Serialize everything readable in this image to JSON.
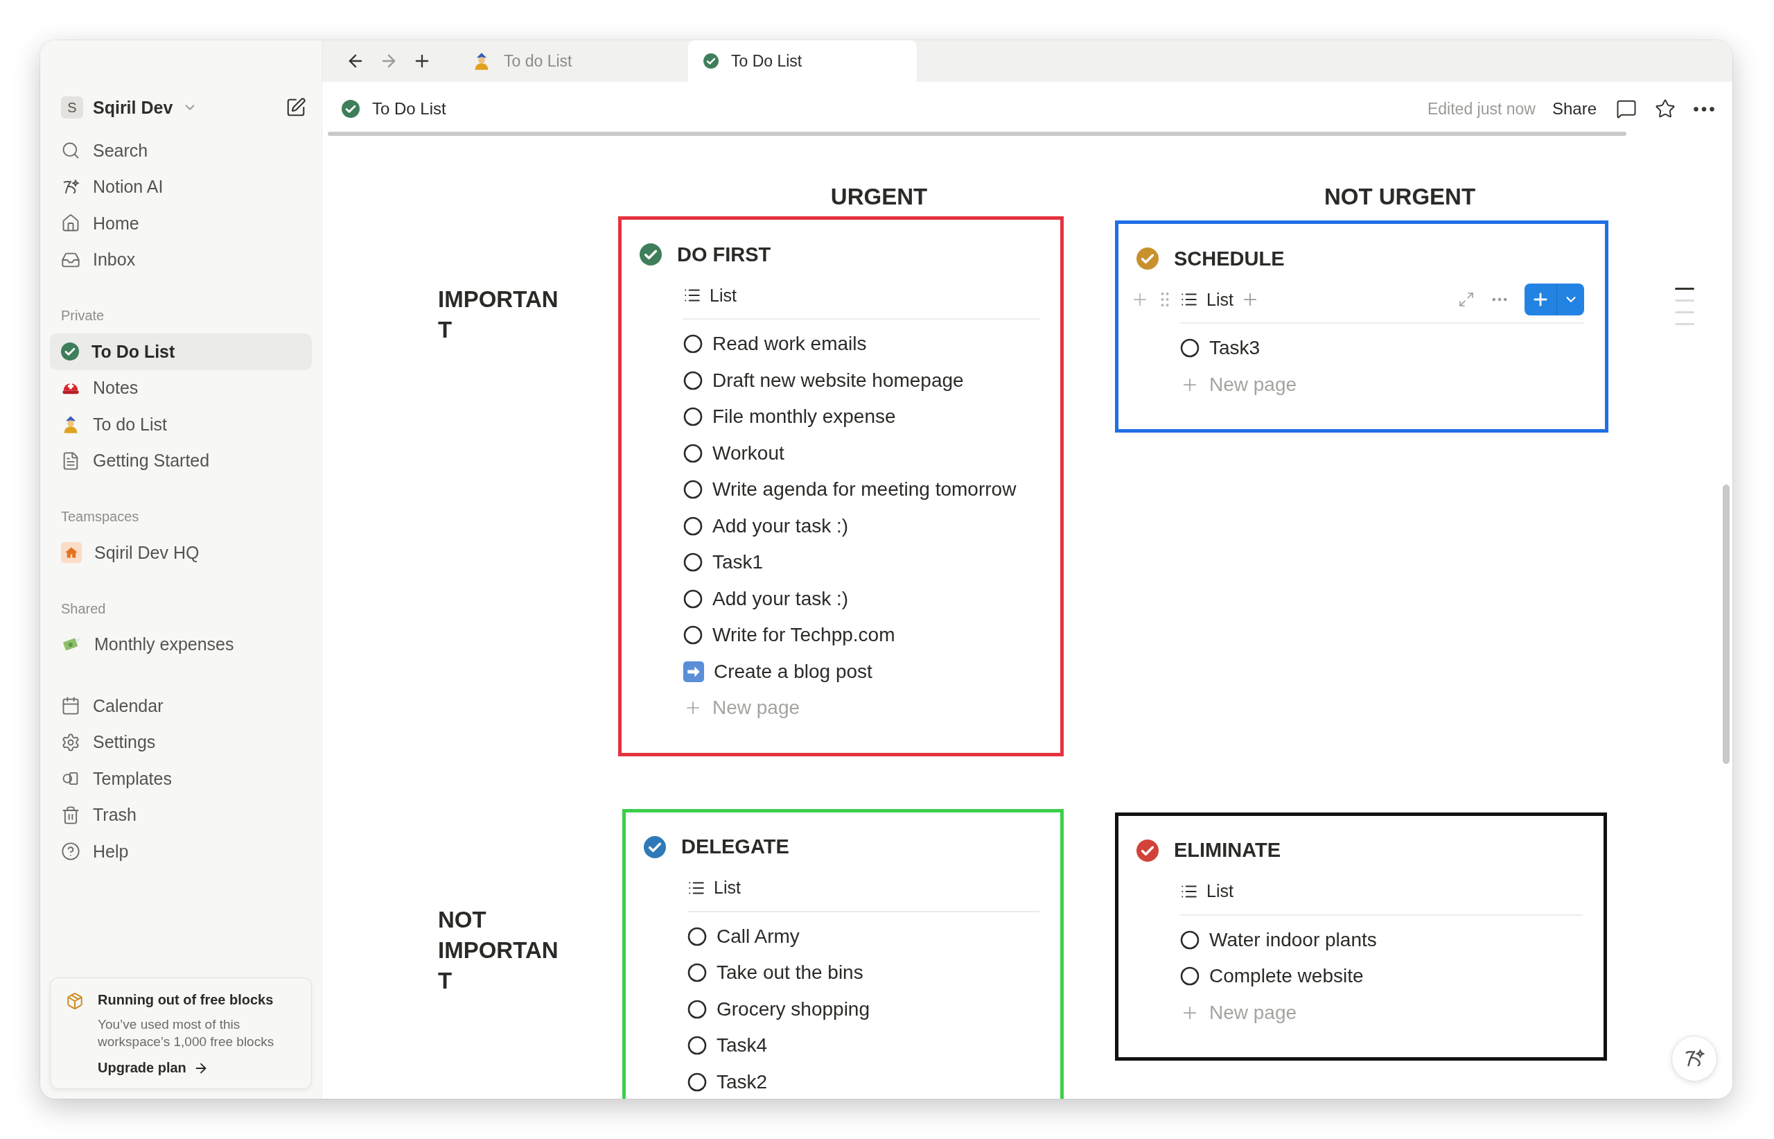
{
  "sidebar": {
    "workspace": {
      "initial": "S",
      "name": "Sqiril Dev"
    },
    "groups": [
      {
        "items": [
          {
            "label": "Search",
            "selected": false
          },
          {
            "label": "Notion AI",
            "selected": false
          },
          {
            "label": "Home",
            "selected": false
          },
          {
            "label": "Inbox",
            "selected": false
          }
        ]
      },
      {
        "title": "Private",
        "items": [
          {
            "label": "To Do List",
            "selected": true
          },
          {
            "label": "Notes",
            "selected": false
          },
          {
            "label": "To do List",
            "selected": false
          },
          {
            "label": "Getting Started",
            "selected": false
          }
        ]
      },
      {
        "title": "Teamspaces",
        "items": [
          {
            "label": "Sqiril Dev HQ",
            "selected": false
          }
        ]
      },
      {
        "title": "Shared",
        "items": [
          {
            "label": "Monthly expenses",
            "selected": false
          }
        ]
      },
      {
        "items": [
          {
            "label": "Calendar",
            "selected": false
          },
          {
            "label": "Settings",
            "selected": false
          },
          {
            "label": "Templates",
            "selected": false
          },
          {
            "label": "Trash",
            "selected": false
          },
          {
            "label": "Help",
            "selected": false
          }
        ]
      }
    ],
    "upgrade": {
      "title": "Running out of free blocks",
      "text": "You’ve used most of this workspace’s 1,000 free blocks",
      "link": "Upgrade plan"
    }
  },
  "tabs": [
    {
      "label": "To do List",
      "selected": false
    },
    {
      "label": "To Do List",
      "selected": true
    }
  ],
  "header": {
    "title": "To Do List",
    "status": "Edited just now",
    "share": "Share"
  },
  "matrix": {
    "columns": [
      "URGENT",
      "NOT URGENT"
    ],
    "rows": [
      {
        "label": "IMPORTANT",
        "quadrants": [
          {
            "title": "DO FIRST",
            "color": "#e5323f",
            "check": {
              "color": "#3f7e5a"
            },
            "view": "List",
            "toolbar": false,
            "items": [
              {
                "label": "Read work emails",
                "kind": "task"
              },
              {
                "label": "Draft new website homepage",
                "kind": "task"
              },
              {
                "label": "File monthly expense",
                "kind": "task"
              },
              {
                "label": "Workout",
                "kind": "task"
              },
              {
                "label": "Write agenda for meeting tomorrow",
                "kind": "task"
              },
              {
                "label": "Add your task :)",
                "kind": "task"
              },
              {
                "label": "Task1",
                "kind": "task"
              },
              {
                "label": "Add your task :)",
                "kind": "task"
              },
              {
                "label": "Write for Techpp.com",
                "kind": "task"
              },
              {
                "label": "Create a blog post",
                "kind": "arrow"
              }
            ],
            "new_page": "New page"
          },
          {
            "title": "SCHEDULE",
            "color": "#1f6fe5",
            "check": {
              "color": "#c8912e"
            },
            "view": "List",
            "toolbar": true,
            "items": [
              {
                "label": "Task3",
                "kind": "task"
              }
            ],
            "new_page": "New page"
          }
        ]
      },
      {
        "label": "NOT IMPORTANT",
        "quadrants": [
          {
            "title": "DELEGATE",
            "color": "#3ccf4a",
            "check": {
              "color": "#2f79b8"
            },
            "view": "List",
            "toolbar": false,
            "items": [
              {
                "label": "Call Army",
                "kind": "task"
              },
              {
                "label": "Take out the bins",
                "kind": "task"
              },
              {
                "label": "Grocery shopping",
                "kind": "task"
              },
              {
                "label": "Task4",
                "kind": "task"
              },
              {
                "label": "Task2",
                "kind": "task"
              }
            ]
          },
          {
            "title": "ELIMINATE",
            "color": "#111111",
            "check": {
              "color": "#d1433a"
            },
            "view": "List",
            "toolbar": false,
            "items": [
              {
                "label": "Water indoor plants",
                "kind": "task"
              },
              {
                "label": "Complete website",
                "kind": "task"
              }
            ],
            "new_page": "New page"
          }
        ]
      }
    ]
  }
}
